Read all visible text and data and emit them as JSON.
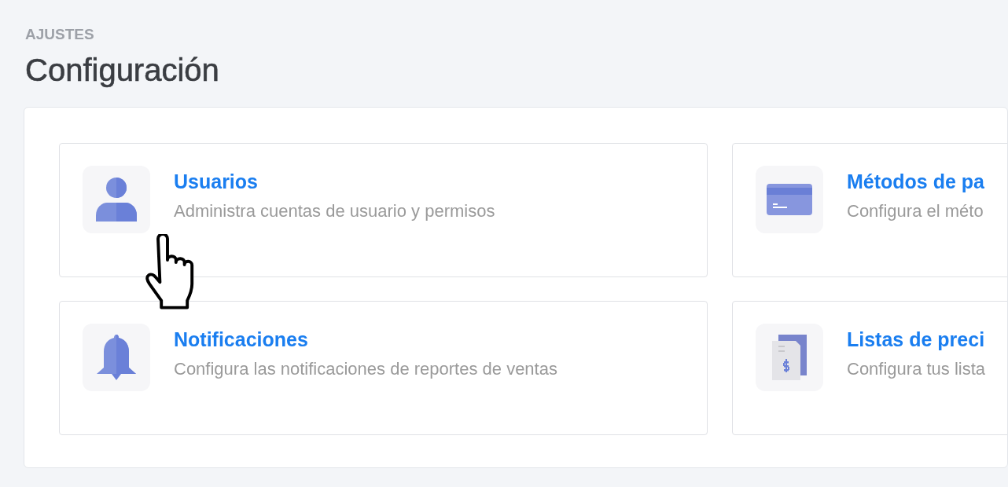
{
  "breadcrumb": "AJUSTES",
  "title": "Configuración",
  "cards": [
    {
      "title": "Usuarios",
      "description": "Administra cuentas de usuario y permisos"
    },
    {
      "title": "Métodos de pa",
      "description": "Configura el méto"
    },
    {
      "title": "Notificaciones",
      "description": "Configura las notificaciones de reportes de ventas"
    },
    {
      "title": "Listas de preci",
      "description": "Configura tus lista"
    }
  ]
}
